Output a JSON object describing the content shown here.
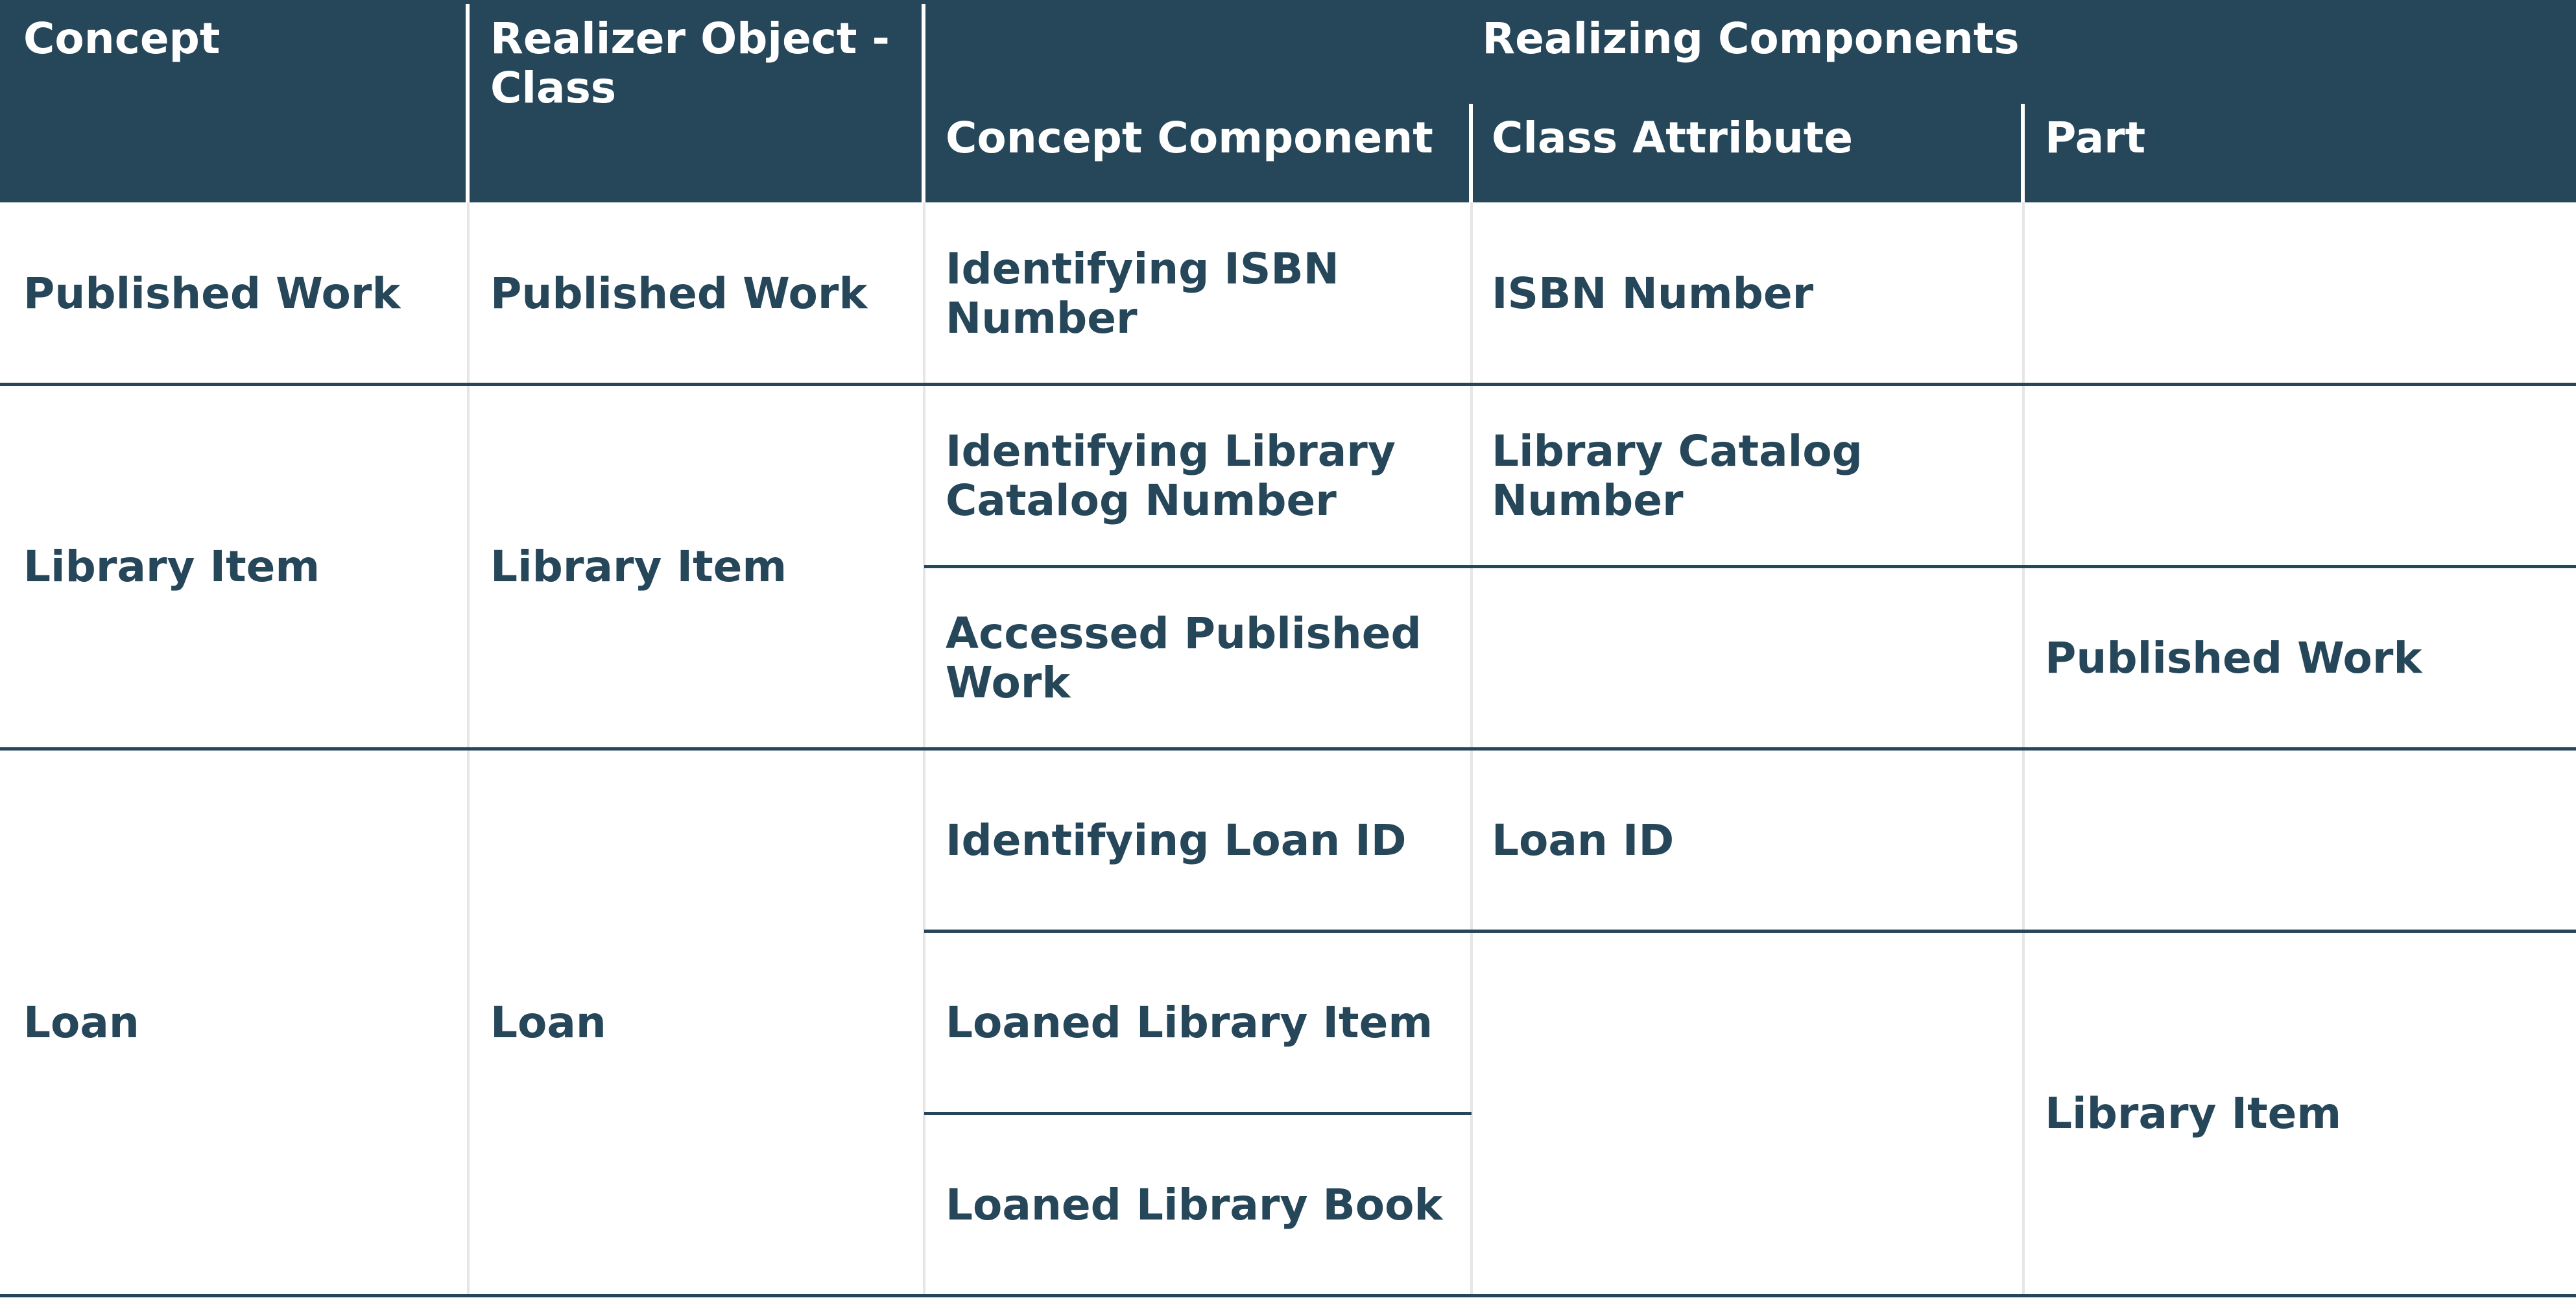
{
  "table": {
    "header": {
      "concept": "Concept",
      "realizer": [
        "Realizer Object -",
        "Class"
      ],
      "group": "Realizing Components",
      "concept_component": "Concept Component",
      "class_attribute": "Class Attribute",
      "part": "Part"
    },
    "rows": [
      {
        "concept": "Published Work",
        "realizer": "Published Work",
        "components": [
          {
            "concept_component": [
              "Identifying ISBN",
              "Number"
            ],
            "class_attribute": [
              "ISBN Number"
            ],
            "part": []
          }
        ]
      },
      {
        "concept": "Library Item",
        "realizer": "Library Item",
        "components": [
          {
            "concept_component": [
              "Identifying Library",
              "Catalog Number"
            ],
            "class_attribute": [
              "Library Catalog",
              "Number"
            ],
            "part": []
          },
          {
            "concept_component": [
              "Accessed Published",
              "Work"
            ],
            "class_attribute": [],
            "part": [
              "Published Work"
            ]
          }
        ]
      },
      {
        "concept": "Loan",
        "realizer": "Loan",
        "components": [
          {
            "concept_component": [
              "Identifying Loan ID"
            ],
            "class_attribute": [
              "Loan ID"
            ],
            "part": []
          },
          {
            "concept_component": [
              "Loaned Library Item"
            ]
          },
          {
            "concept_component": [
              "Loaned Library Book"
            ]
          }
        ],
        "merged_part": "Library Item"
      }
    ]
  },
  "colors": {
    "header_background": "#264659",
    "header_text": "#ffffff",
    "body_text": "#264659",
    "row_border": "#264659",
    "column_border": "#e6e6e6"
  }
}
